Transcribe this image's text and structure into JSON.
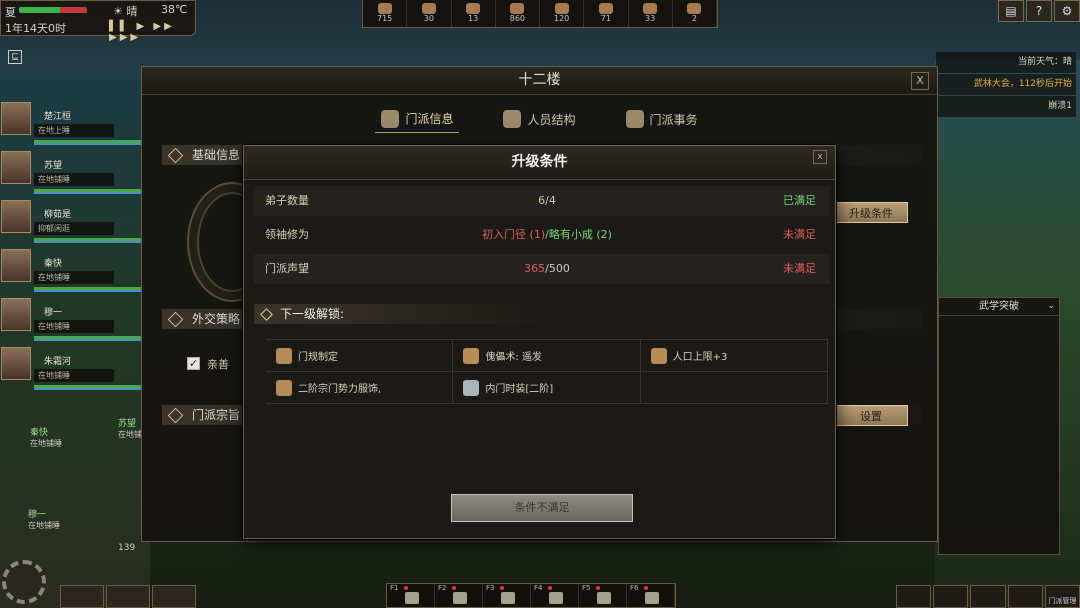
{
  "hud": {
    "season": "夏",
    "weather_icon": "sun-icon",
    "weather": "晴",
    "temp": "38℃",
    "date": "1年14天0时",
    "speed_controls": "▌▌ ▶ ▶▶ ▶▶▶"
  },
  "resources": [
    {
      "icon": "wood-icon",
      "value": "715"
    },
    {
      "icon": "stone-icon",
      "value": "30"
    },
    {
      "icon": "coin-icon",
      "value": "13"
    },
    {
      "icon": "grain-icon",
      "value": "860"
    },
    {
      "icon": "meat-icon",
      "value": "120"
    },
    {
      "icon": "ore-icon",
      "value": "71"
    },
    {
      "icon": "cloth-icon",
      "value": "33"
    },
    {
      "icon": "book-icon",
      "value": "2"
    }
  ],
  "right_info": {
    "weather_line": "当前天气：晴",
    "event_line": "武林大会，112秒后开始",
    "collapse": "崩溃1"
  },
  "roster": [
    {
      "name": "楚江桓",
      "status": "在地上睡"
    },
    {
      "name": "苏望",
      "status": "在地铺睡"
    },
    {
      "name": "柳茹是",
      "status": "抑郁闲逛"
    },
    {
      "name": "秦快",
      "status": "在地铺睡"
    },
    {
      "name": "穆一",
      "status": "在地铺睡"
    },
    {
      "name": "朱霜河",
      "status": "在地铺睡"
    }
  ],
  "field_labels": [
    {
      "name": "秦快",
      "status": "在地铺睡"
    },
    {
      "name": "苏望",
      "status": "在地铺"
    },
    {
      "name": "穆一",
      "status": "在地铺睡"
    }
  ],
  "counter": "139",
  "main": {
    "title": "十二楼",
    "tabs": [
      {
        "label": "门派信息",
        "active": true
      },
      {
        "label": "人员结构",
        "active": false
      },
      {
        "label": "门派事务",
        "active": false
      }
    ],
    "sections": {
      "basic": "基础信息",
      "diplomacy": "外交策略",
      "tenet": "门派宗旨"
    },
    "checkbox_label": "亲善",
    "upgrade_button": "升级条件",
    "settings_button": "设置"
  },
  "dialog": {
    "title": "升级条件",
    "close": "x",
    "conditions": [
      {
        "name": "弟子数量",
        "value_html": "6/4",
        "value_parts": [
          {
            "text": "6/4",
            "cls": "tot"
          }
        ],
        "status": "已满足",
        "met": true
      },
      {
        "name": "领袖修为",
        "value_parts": [
          {
            "text": "初入门径 (1)",
            "cls": "cur"
          },
          {
            "text": "/略有小成 (2)",
            "cls": "ok"
          }
        ],
        "status": "未满足",
        "met": false
      },
      {
        "name": "门派声望",
        "value_parts": [
          {
            "text": "365",
            "cls": "cur"
          },
          {
            "text": "/500",
            "cls": "tot"
          }
        ],
        "status": "未满足",
        "met": false
      }
    ],
    "unlock_title": "下一级解锁:",
    "unlocks": [
      {
        "label": "门规制定",
        "icon": "scroll-icon",
        "style": "gold"
      },
      {
        "label": "傀儡术: 遥发",
        "icon": "puppet-book-icon",
        "style": "gold"
      },
      {
        "label": "人口上限+3",
        "icon": "house-icon",
        "style": "gold"
      },
      {
        "label": "二阶宗门势力服饰,",
        "icon": "robe-icon",
        "style": "gold"
      },
      {
        "label": "内门时装[二阶]",
        "icon": "costume-icon",
        "style": "gray"
      },
      {
        "label": "",
        "icon": "",
        "style": "empty"
      }
    ],
    "confirm_button": "条件不满足"
  },
  "side_panel": {
    "title": "武学突破"
  },
  "toolbar": [
    {
      "key": "F1"
    },
    {
      "key": "F2"
    },
    {
      "key": "F3"
    },
    {
      "key": "F4"
    },
    {
      "key": "F5"
    },
    {
      "key": "F6"
    }
  ],
  "bottom_right_label": "门派管理"
}
